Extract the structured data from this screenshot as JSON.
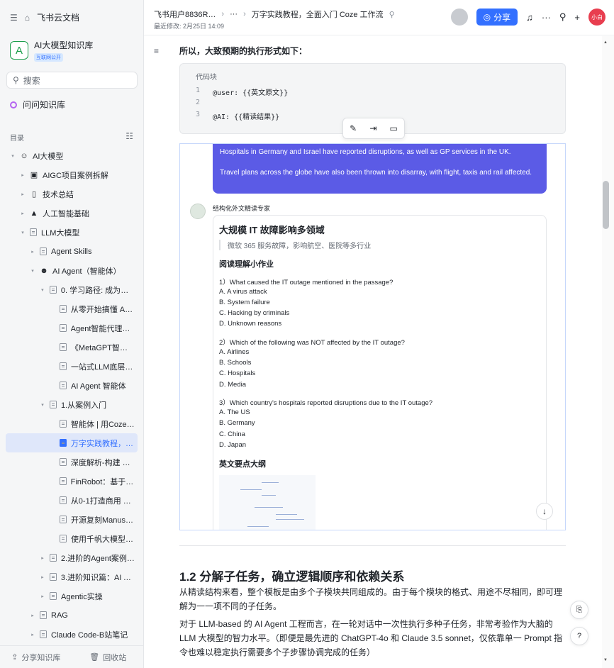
{
  "sidebar": {
    "brand": "飞书云文档",
    "kb_name": "AI大模型知识库",
    "kb_badge": "互联网公开",
    "kb_initial": "A",
    "search_placeholder": "搜索",
    "ask": "问问知识库",
    "toc_title": "目录",
    "tree": [
      {
        "label": "AI大模型",
        "depth": 0,
        "caret": "▾",
        "icon": "☺"
      },
      {
        "label": "AIGC项目案例拆解",
        "depth": 1,
        "caret": "▸",
        "icon": "▣"
      },
      {
        "label": "技术总结",
        "depth": 1,
        "caret": "▸",
        "icon": "▯"
      },
      {
        "label": "人工智能基础",
        "depth": 1,
        "caret": "▸",
        "icon": "▲"
      },
      {
        "label": "LLM大模型",
        "depth": 1,
        "caret": "▾",
        "icon": "doc"
      },
      {
        "label": "Agent Skills",
        "depth": 2,
        "caret": "▸",
        "icon": "doc"
      },
      {
        "label": "AI Agent（智能体）",
        "depth": 2,
        "caret": "▾",
        "icon": "☻"
      },
      {
        "label": "0. 学习路径: 成为基…",
        "depth": 3,
        "caret": "▾",
        "icon": "doc"
      },
      {
        "label": "从零开始搞懂 AI …",
        "depth": 4,
        "caret": "",
        "icon": "doc"
      },
      {
        "label": "Agent智能代理开…",
        "depth": 4,
        "caret": "",
        "icon": "doc"
      },
      {
        "label": "《MetaGPT智能…",
        "depth": 4,
        "caret": "",
        "icon": "doc"
      },
      {
        "label": "一站式LLM底层…",
        "depth": 4,
        "caret": "",
        "icon": "doc"
      },
      {
        "label": "AI Agent 智能体",
        "depth": 4,
        "caret": "",
        "icon": "doc"
      },
      {
        "label": "1.从案例入门",
        "depth": 3,
        "caret": "▾",
        "icon": "doc"
      },
      {
        "label": "智能体 | 用Coze…",
        "depth": 4,
        "caret": "",
        "icon": "doc"
      },
      {
        "label": "万字实践教程，…",
        "depth": 4,
        "caret": "",
        "icon": "doc",
        "selected": true
      },
      {
        "label": "深度解析-构建 A…",
        "depth": 4,
        "caret": "",
        "icon": "doc"
      },
      {
        "label": "FinRobot：基于L…",
        "depth": 4,
        "caret": "",
        "icon": "doc"
      },
      {
        "label": "从0-1打造商用 A…",
        "depth": 4,
        "caret": "",
        "icon": "doc"
      },
      {
        "label": "开源复刻Manus…",
        "depth": 4,
        "caret": "",
        "icon": "doc"
      },
      {
        "label": "使用千帆大模型…",
        "depth": 4,
        "caret": "",
        "icon": "doc"
      },
      {
        "label": "2.进阶的Agent案例…",
        "depth": 3,
        "caret": "▸",
        "icon": "doc"
      },
      {
        "label": "3.进阶知识篇：AI A…",
        "depth": 3,
        "caret": "▸",
        "icon": "doc"
      },
      {
        "label": "Agentic实操",
        "depth": 3,
        "caret": "▸",
        "icon": "doc"
      },
      {
        "label": "RAG",
        "depth": 2,
        "caret": "▸",
        "icon": "doc"
      },
      {
        "label": "Claude Code-B站笔记",
        "depth": 2,
        "caret": "▸",
        "icon": "doc"
      }
    ],
    "footer_share": "分享知识库",
    "footer_trash": "回收站"
  },
  "header": {
    "crumb_user": "飞书用户8836R…",
    "crumb_more": "···",
    "crumb_title": "万字实践教程，全面入门 Coze 工作流",
    "modified": "最近修改: 2月25日 14:09",
    "share": "分享",
    "user_avatar": "小白"
  },
  "doc": {
    "lead": "所以，大致预期的执行形式如下：",
    "code_title": "代码块",
    "code_lines": [
      {
        "n": "1",
        "t": "@user: {{英文原文}}"
      },
      {
        "n": "2",
        "t": ""
      },
      {
        "n": "3",
        "t": "@AI: {{精读结果}}"
      }
    ],
    "bubble_1": "Hospitals in Germany and Israel have reported disruptions, as well as GP services in the UK.",
    "bubble_2": "Travel plans across the globe have also been thrown into disarray, with flight, taxis and rail affected.",
    "bot_name": "结构化外文精读专家",
    "card_title": "大规模 IT 故障影响多领域",
    "card_quote": "微软 365 服务故障，影响航空、医院等多行业",
    "reading_title": "阅读理解小作业",
    "questions": [
      {
        "q": "1）What caused the IT outage mentioned in the passage?",
        "opts": [
          "A. A virus attack",
          "B. System failure",
          "C. Hacking by criminals",
          "D. Unknown reasons"
        ]
      },
      {
        "q": "2）Which of the following was NOT affected by the IT outage?",
        "opts": [
          "A. Airlines",
          "B. Schools",
          "C. Hospitals",
          "D. Media"
        ]
      },
      {
        "q": "3）Which country's hospitals reported disruptions due to the IT outage?",
        "opts": [
          "A. The US",
          "B. Germany",
          "C. China",
          "D. Japan"
        ]
      }
    ],
    "keypoints_title": "英文要点大纲",
    "h2": "1.2 分解子任务，确立逻辑顺序和依赖关系",
    "p1": "从精读结构来看，整个模板是由多个子模块共同组成的。由于每个模块的格式、用途不尽相同，即可理解为一一项不同的子任务。",
    "p2": "对于 LLM-based 的 AI Agent 工程而言，在一轮对话中一次性执行多种子任务，非常考验作为大脑的 LLM 大模型的智力水平。（即便是最先进的 ChatGPT-4o 和 Claude 3.5 sonnet，仅依靠单一 Prompt 指令也难以稳定执行需要多个子步骤协调完成的任务）"
  }
}
